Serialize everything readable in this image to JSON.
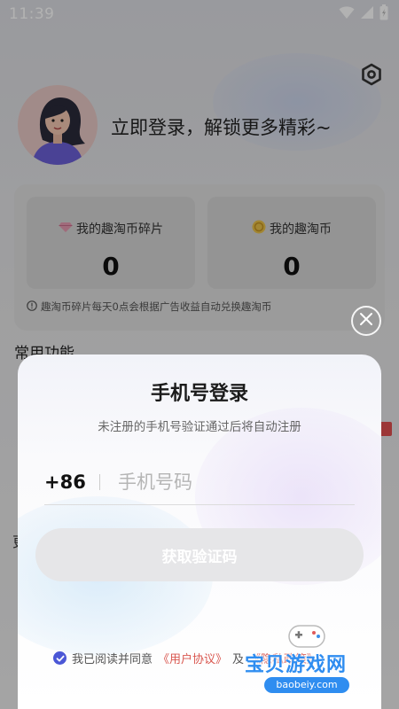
{
  "status_bar": {
    "time": "11:39"
  },
  "profile": {
    "login_prompt": "立即登录，解锁更多精彩~"
  },
  "coins": {
    "fragments_label": "我的趣淘币碎片",
    "fragments_value": "0",
    "coins_label": "我的趣淘币",
    "coins_value": "0",
    "note": "趣淘币碎片每天0点会根据广告收益自动兑换趣淘币"
  },
  "section": {
    "common_functions": "常用功能"
  },
  "modal": {
    "title": "手机号登录",
    "subtitle": "未注册的手机号验证通过后将自动注册",
    "country_code": "+86",
    "phone_placeholder": "手机号码",
    "get_code_button": "获取验证码",
    "agreement_prefix": "我已阅读并同意",
    "user_agreement": "《用户协议》",
    "agreement_and": "及",
    "privacy_policy": "《隐私政策》"
  },
  "watermark": {
    "text": "宝贝游戏网",
    "url": "baobeiy.com"
  },
  "colors": {
    "accent": "#4b57d6",
    "link": "#d9574f",
    "button_disabled": "#e6e6e8"
  },
  "icons": [
    "wifi-icon",
    "signal-icon",
    "battery-icon",
    "settings-icon",
    "close-icon",
    "check-icon",
    "info-icon"
  ]
}
